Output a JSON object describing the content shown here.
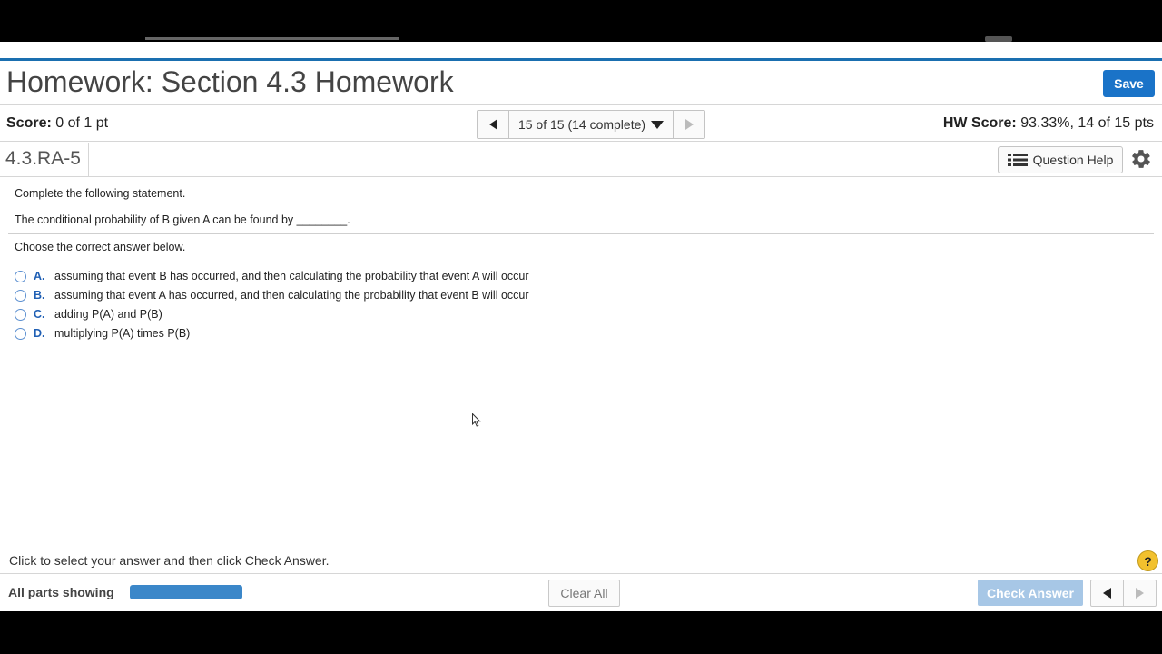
{
  "header": {
    "title": "Homework: Section 4.3 Homework",
    "save_label": "Save"
  },
  "score_bar": {
    "score_label": "Score:",
    "score_value": "0 of 1 pt",
    "pager_label": "15 of 15 (14 complete)",
    "hw_score_label": "HW Score:",
    "hw_score_value": "93.33%, 14 of 15 pts"
  },
  "question_bar": {
    "question_id": "4.3.RA-5",
    "help_label": "Question Help"
  },
  "question": {
    "instruction": "Complete the following statement.",
    "statement": "The conditional probability of B given A can be found by ________.",
    "prompt": "Choose the correct answer below.",
    "options": [
      {
        "letter": "A.",
        "text": "assuming that event B has occurred, and then calculating the probability that event A will occur"
      },
      {
        "letter": "B.",
        "text": "assuming that event A has occurred, and then calculating the probability that event B will occur"
      },
      {
        "letter": "C.",
        "text": "adding P(A) and P(B)"
      },
      {
        "letter": "D.",
        "text": "multiplying P(A) times P(B)"
      }
    ]
  },
  "footer": {
    "instruction": "Click to select your answer and then click Check Answer.",
    "help_symbol": "?",
    "all_parts_label": "All parts showing",
    "progress_fraction": 1.0,
    "clear_all_label": "Clear All",
    "check_answer_label": "Check Answer"
  },
  "colors": {
    "accent": "#1a73c8",
    "header_rule": "#1a6fb0",
    "check_disabled": "#a7c7e6",
    "option_letter": "#1f5fb4",
    "help_yellow": "#f2c12e"
  }
}
